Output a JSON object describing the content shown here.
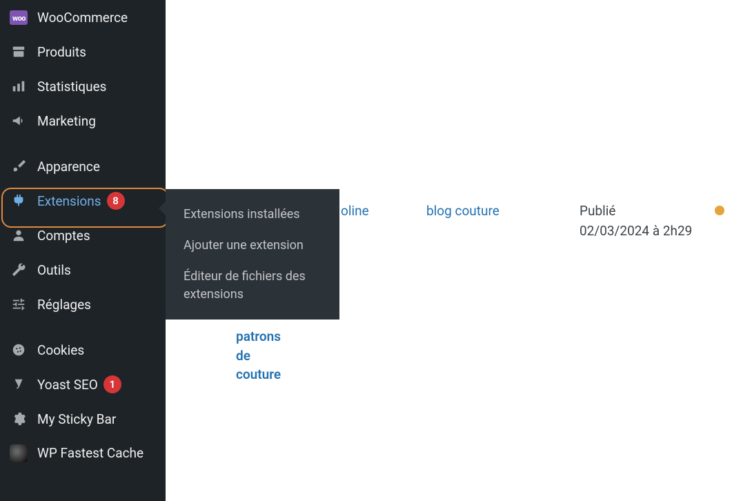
{
  "sidebar": {
    "items": [
      {
        "label": "WooCommerce"
      },
      {
        "label": "Produits"
      },
      {
        "label": "Statistiques"
      },
      {
        "label": "Marketing"
      },
      {
        "label": "Apparence"
      },
      {
        "label": "Extensions",
        "badge": "8"
      },
      {
        "label": "Comptes"
      },
      {
        "label": "Outils"
      },
      {
        "label": "Réglages"
      },
      {
        "label": "Cookies"
      },
      {
        "label": "Yoast SEO",
        "badge": "1"
      },
      {
        "label": "My Sticky Bar"
      },
      {
        "label": "WP Fastest Cache"
      }
    ]
  },
  "submenu": {
    "items": [
      "Extensions installées",
      "Ajouter une extension",
      "Éditeur de fichiers des extensions"
    ]
  },
  "content": {
    "author": "oline",
    "category": "blog couture",
    "published_label": "Publié",
    "published_date": "02/03/2024 à 2h29",
    "title_tail": "patrons de couture"
  }
}
